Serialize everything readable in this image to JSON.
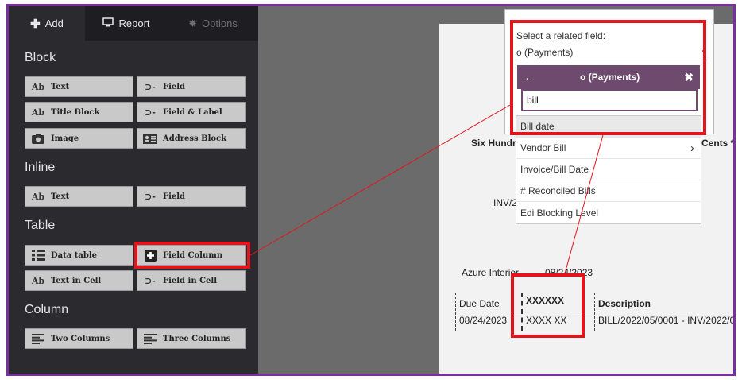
{
  "tabs": [
    {
      "icon": "plus-icon",
      "label": "Add"
    },
    {
      "icon": "monitor-icon",
      "label": "Report"
    },
    {
      "icon": "gear-icon",
      "label": "Options"
    }
  ],
  "sections": {
    "block": "Block",
    "inline": "Inline",
    "table": "Table",
    "column": "Column"
  },
  "buttons": {
    "text": "Text",
    "field": "Field",
    "title_block": "Title Block",
    "field_label": "Field & Label",
    "image": "Image",
    "address_block": "Address Block",
    "inline_text": "Text",
    "inline_field": "Field",
    "data_table": "Data table",
    "field_column": "Field Column",
    "text_in_cell": "Text in Cell",
    "field_in_cell": "Field in Cell",
    "two_columns": "Two Columns",
    "three_columns": "Three Columns"
  },
  "icon_text": {
    "ab": "Ab"
  },
  "popup": {
    "label": "Select a related field:",
    "selected_value": "o (Payments)",
    "panel_title": "o (Payments)",
    "search_value": "bill",
    "options": [
      "Bill date",
      "Vendor Bill",
      "Invoice/Bill Date",
      "# Reconciled Bills",
      "Edi Blocking Level"
    ]
  },
  "document": {
    "amount_text_left": "Six Hundre",
    "amount_text_right": "Cents **",
    "inv_ref": "INV/2",
    "partner": "Azure Interior",
    "date": "08/24/2023",
    "col_due_date": "Due Date",
    "col_placeholder": "XXXXXX",
    "col_description": "Description",
    "row_due_date": "08/24/2023",
    "row_placeholder": "XXXX XX",
    "row_description": "BILL/2022/05/0001 - INV/2022/0"
  },
  "colors": {
    "highlight": "#e4141c",
    "frame": "#7a2f9e",
    "panel": "#6e4b6e"
  }
}
